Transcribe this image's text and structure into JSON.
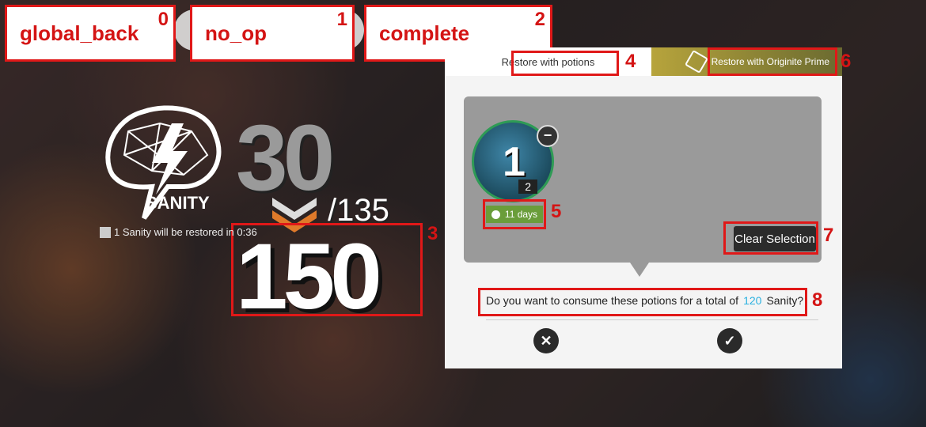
{
  "annotations": [
    {
      "label": "global_back",
      "index": "0"
    },
    {
      "label": "no_op",
      "index": "1"
    },
    {
      "label": "complete",
      "index": "2"
    }
  ],
  "marker_numbers": {
    "new_value": "3",
    "tab_potions": "4",
    "expiry": "5",
    "tab_originite": "6",
    "clear": "7",
    "confirm_text": "8"
  },
  "sanity": {
    "logo_text": "SANITY",
    "current": "30",
    "max": "/135",
    "new_value": "150",
    "restore_note": "1 Sanity will be restored in",
    "restore_time": "0:36"
  },
  "dialog": {
    "tab_potions": "Restore with potions",
    "tab_originite": "Restore with Originite Prime",
    "potion_selected": "1",
    "potion_owned": "2",
    "expiry": "11 days",
    "clear_label": "Clear Selection",
    "confirm_prefix": "Do you want to consume these potions for a total of",
    "confirm_amount": "120",
    "confirm_suffix": "Sanity?",
    "cancel_icon": "close-icon",
    "ok_icon": "check-icon"
  },
  "colors": {
    "accent_blue": "#2bb1e0",
    "expiry_green": "#6a9d3a",
    "annotation_red": "#e01818"
  }
}
